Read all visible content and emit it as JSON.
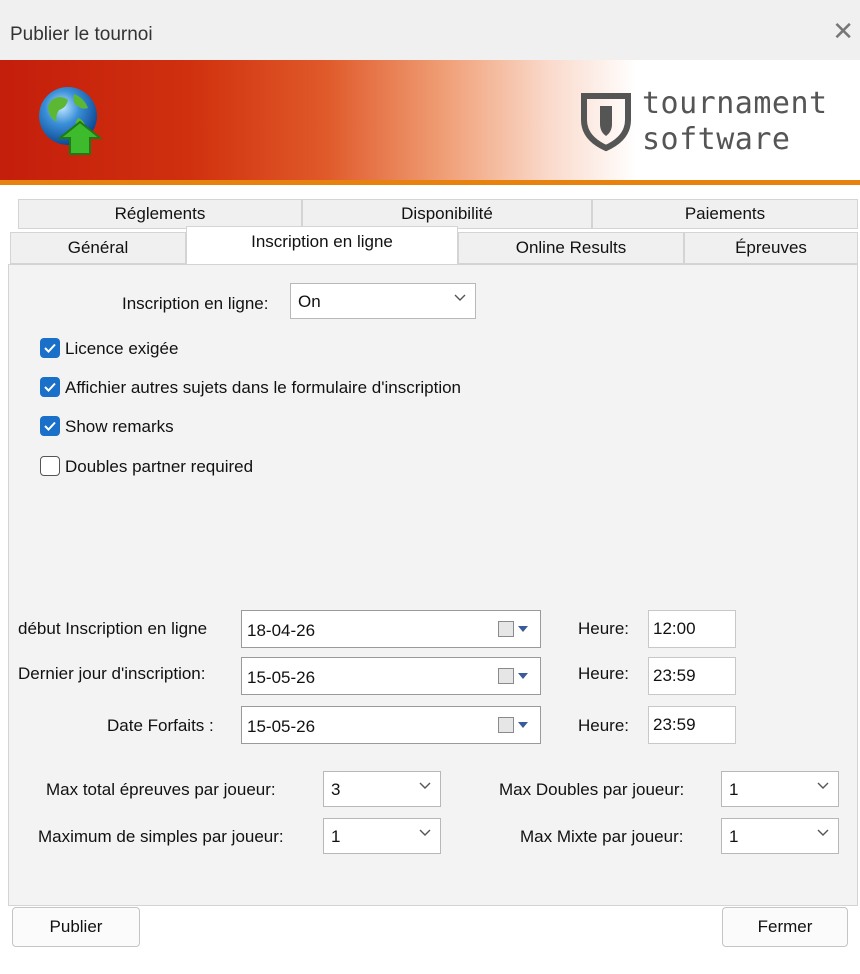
{
  "window": {
    "title": "Publier le tournoi"
  },
  "brand": {
    "line1": "tournament",
    "line2": "software"
  },
  "tabs": {
    "row1": [
      "Réglements",
      "Disponibilité",
      "Paiements"
    ],
    "row2": [
      "Général",
      "Inscription en ligne",
      "Online Results",
      "Épreuves"
    ],
    "active": "Inscription en ligne"
  },
  "online_registration": {
    "label": "Inscription en ligne:",
    "value": "On"
  },
  "checkboxes": [
    {
      "label": "Licence exigée",
      "checked": true
    },
    {
      "label": "Affichier autres sujets dans le formulaire d'inscription",
      "checked": true
    },
    {
      "label": "Show remarks",
      "checked": true
    },
    {
      "label": "Doubles partner required",
      "checked": false
    }
  ],
  "dates": [
    {
      "label": "début Inscription en ligne",
      "date": "18-04-26",
      "time_label": "Heure:",
      "time": "12:00"
    },
    {
      "label": "Dernier jour d'inscription:",
      "date": "15-05-26",
      "time_label": "Heure:",
      "time": "23:59"
    },
    {
      "label": "Date Forfaits :",
      "date": "15-05-26",
      "time_label": "Heure:",
      "time": "23:59"
    }
  ],
  "limits": {
    "max_total": {
      "label": "Max total épreuves par joueur:",
      "value": "3"
    },
    "max_singles": {
      "label": "Maximum de simples par joueur:",
      "value": "1"
    },
    "max_doubles": {
      "label": "Max Doubles par joueur:",
      "value": "1"
    },
    "max_mixed": {
      "label": "Max Mixte par joueur:",
      "value": "1"
    }
  },
  "buttons": {
    "publish": "Publier",
    "close": "Fermer"
  },
  "colors": {
    "checkbox_accent": "#1a6fc9",
    "banner_red": "#c41e0c",
    "banner_accent": "#e8820e"
  }
}
